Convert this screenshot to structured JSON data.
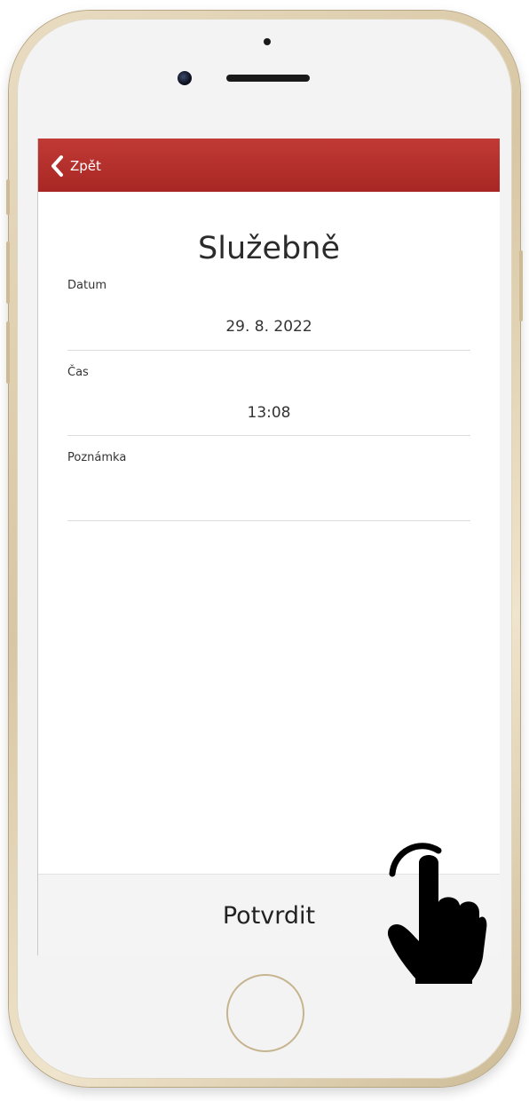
{
  "header": {
    "back_label": "Zpět"
  },
  "page": {
    "title": "Služebně"
  },
  "form": {
    "date_label": "Datum",
    "date_value": "29. 8. 2022",
    "time_label": "Čas",
    "time_value": "13:08",
    "note_label": "Poznámka",
    "note_value": ""
  },
  "footer": {
    "confirm_label": "Potvrdit"
  },
  "colors": {
    "header_red": "#b3302c",
    "phone_gold": "#d8c7a4"
  },
  "icons": {
    "back": "chevron-left-icon",
    "hand": "pointing-hand-icon"
  }
}
